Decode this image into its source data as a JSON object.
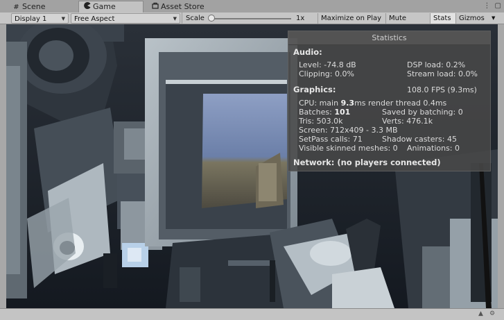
{
  "tabs": [
    {
      "label": "Scene",
      "icon": "grid-icon"
    },
    {
      "label": "Game",
      "icon": "pacman-icon"
    },
    {
      "label": "Asset Store",
      "icon": "store-icon"
    }
  ],
  "window_controls": {
    "more": "⋮",
    "maximize": "▢"
  },
  "toolbar": {
    "display": "Display 1",
    "aspect": "Free Aspect",
    "scale_label": "Scale",
    "scale_value": "1x",
    "scale_fraction": 0,
    "maximize_on_play": "Maximize on Play",
    "mute_audio": "Mute audio",
    "stats": "Stats",
    "gizmos": "Gizmos"
  },
  "statistics": {
    "title": "Statistics",
    "audio": {
      "heading": "Audio:",
      "level": "Level: -74.8 dB",
      "dsp_load": "DSP load: 0.2%",
      "clipping": "Clipping: 0.0%",
      "stream_load": "Stream load: 0.0%"
    },
    "graphics": {
      "heading": "Graphics:",
      "fps": "108.0 FPS (9.3ms)",
      "cpu_prefix": "CPU: main ",
      "cpu_main": "9.3",
      "cpu_suffix": "ms  render thread 0.4ms",
      "batches_prefix": "Batches: ",
      "batches": "101",
      "saved_by_batching": "Saved by batching: 0",
      "tris": "Tris: 503.0k",
      "verts": "Verts: 476.1k",
      "screen": "Screen: 712x409 - 3.3 MB",
      "setpass": "SetPass calls: 71",
      "shadow_casters": "Shadow casters: 45",
      "skinned": "Visible skinned meshes: 0",
      "animations": "Animations: 0"
    },
    "network": "Network: (no players connected)"
  },
  "colors": {
    "overlay_bg": "#484848",
    "toolbar_bg": "#c6c6c6",
    "tab_bg": "#a2a2a2"
  }
}
